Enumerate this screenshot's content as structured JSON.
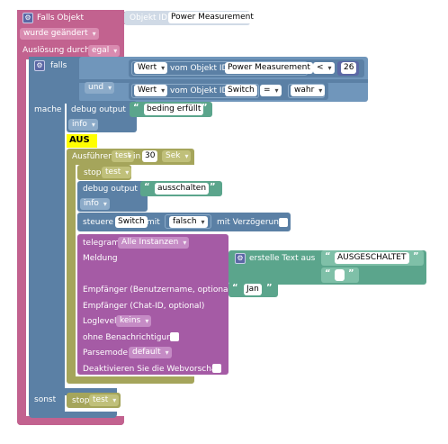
{
  "trigger": {
    "title": "Falls Objekt",
    "objekt_id_label": "Objekt ID",
    "objekt_id_value": "Power Measurement",
    "changed_option": "wurde geändert",
    "ausloesung_label": "Auslösung durch",
    "ausloesung_value": "egal"
  },
  "if_block": {
    "falls_label": "falls",
    "cond1": {
      "left": "Wert",
      "mid": "vom Objekt ID",
      "object": "Power Measurement",
      "op": "<",
      "number": "26"
    },
    "connector": "und",
    "cond2": {
      "left": "Wert",
      "mid": "vom Objekt ID",
      "object": "Switch",
      "op": "=",
      "value": "wahr"
    },
    "mache_label": "mache",
    "sonst_label": "sonst"
  },
  "do_block": {
    "debug1_label": "debug output",
    "debug1_text": "beding erfüllt",
    "debug1_level": "info",
    "aus_text": "AUS",
    "timer": {
      "label": "Ausführen",
      "name": "test",
      "in_label": "in",
      "value": "30",
      "unit": "Sek"
    },
    "stop_label": "stop",
    "stop_name": "test",
    "debug2_label": "debug output",
    "debug2_text": "ausschalten",
    "debug2_level": "info",
    "steuere": {
      "label": "steuere",
      "object": "Switch",
      "mit_label": "mit",
      "value": "falsch",
      "delay_label": "mit Verzögerung"
    }
  },
  "telegram": {
    "label": "telegram",
    "instance": "Alle Instanzen",
    "meldung_label": "Meldung",
    "text_block_label": "erstelle Text aus",
    "text1": "AUSGESCHALTET",
    "text2": "",
    "empfaenger_label": "Empfänger (Benutzername, optional)",
    "empfaenger_value": "Jan",
    "chat_id_label": "Empfänger (Chat-ID, optional)",
    "loglevel_label": "Loglevel",
    "loglevel_value": "keins",
    "silent_label": "ohne Benachrichtigung",
    "parsemode_label": "Parsemode",
    "parsemode_value": "default",
    "preview_label": "Deaktivieren Sie die Webvorschau"
  },
  "else_block": {
    "stop_label": "stop",
    "stop_name": "test"
  },
  "colors": {
    "trigger": "#c2628f",
    "logic": "#5b80a5",
    "timer": "#a5a55b",
    "text": "#5ba58c",
    "telegram": "#a55ba5",
    "highlight": "#ffff00"
  }
}
